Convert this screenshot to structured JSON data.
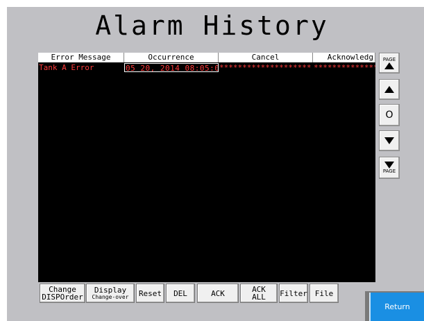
{
  "title": "Alarm History",
  "table": {
    "columns": [
      "Error Message",
      "Occurrence",
      "Cancel",
      "Acknowledg"
    ],
    "rows": [
      {
        "message": "Tank A Error",
        "occurrence": "05 20, 2014 08:05:02",
        "cancel": "********************",
        "acknowledge": "**************"
      }
    ]
  },
  "side": {
    "page_up": "PAGE",
    "center": "O",
    "page_down": "PAGE"
  },
  "buttons": {
    "change_l1": "Change",
    "change_l2": "DISPOrder",
    "display_l1": "Display",
    "display_l2": "Change-over",
    "reset": "Reset",
    "del": "DEL",
    "ack": "ACK",
    "ack_all_l1": "ACK",
    "ack_all_l2": "ALL",
    "filter": "Filter",
    "file": "File",
    "return": "Return"
  },
  "colors": {
    "panel": "#c0c0c4",
    "alarm_text": "#ff3b3b",
    "return_button": "#1a8fe3"
  }
}
